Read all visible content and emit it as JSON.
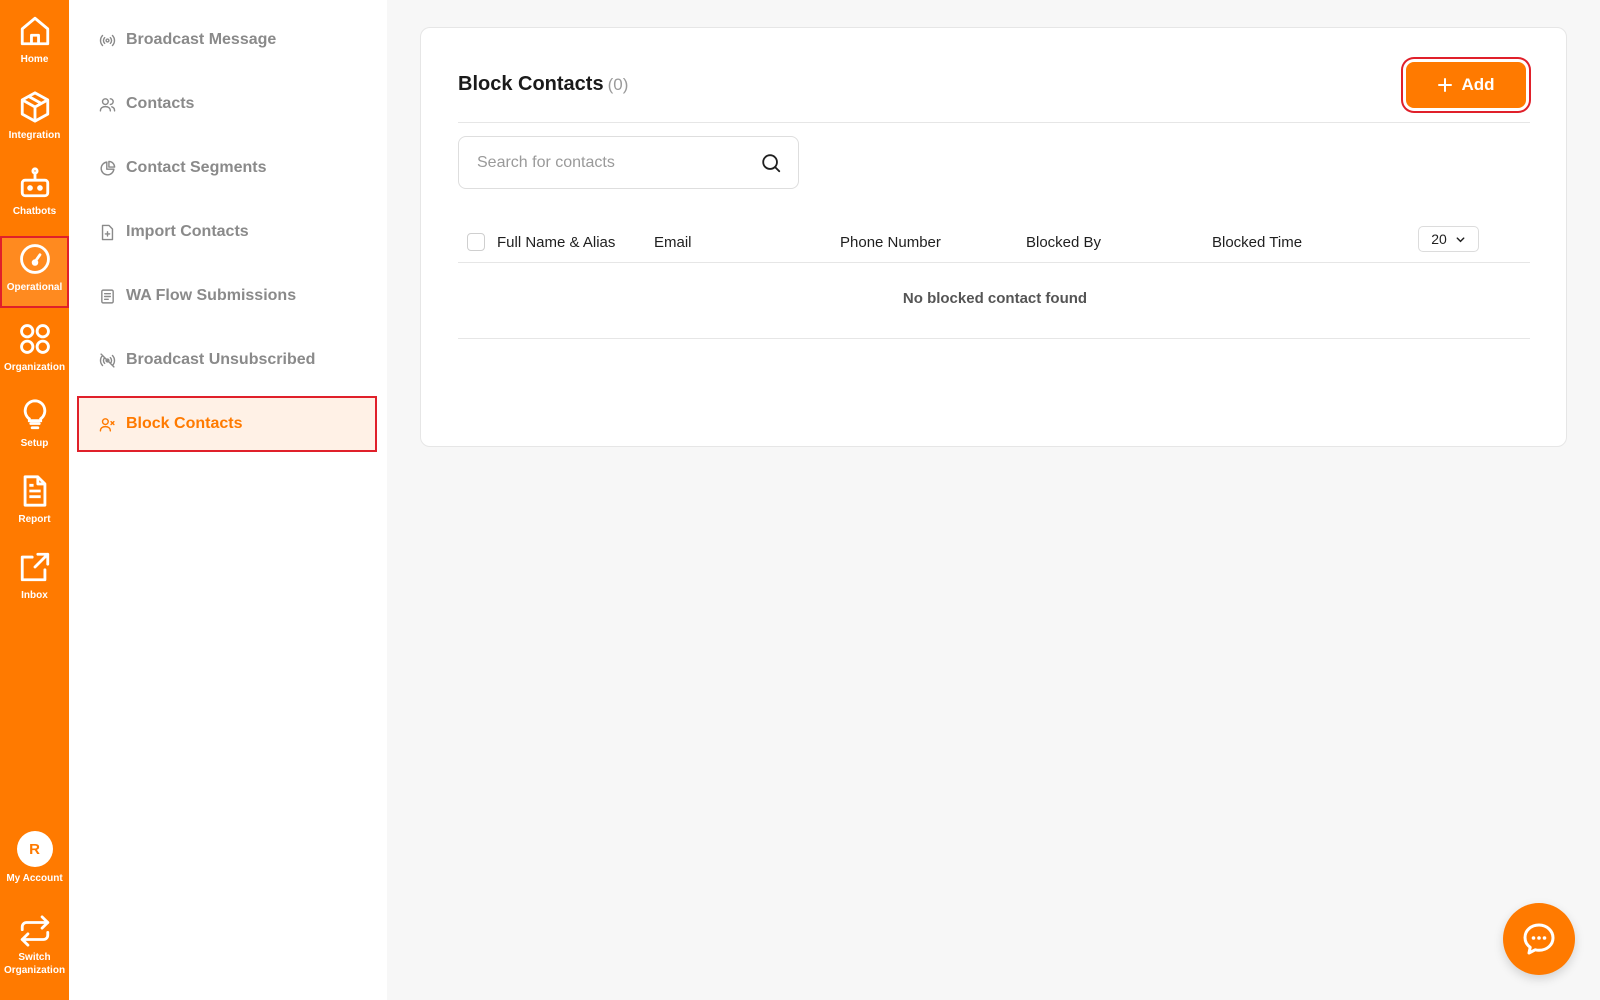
{
  "rail": {
    "items": [
      {
        "label": "Home",
        "icon": "home-icon"
      },
      {
        "label": "Integration",
        "icon": "cube-icon"
      },
      {
        "label": "Chatbots",
        "icon": "robot-icon"
      },
      {
        "label": "Operational",
        "icon": "gauge-icon"
      },
      {
        "label": "Organization",
        "icon": "grid-circles-icon"
      },
      {
        "label": "Setup",
        "icon": "lightbulb-icon"
      },
      {
        "label": "Report",
        "icon": "document-icon"
      },
      {
        "label": "Inbox",
        "icon": "external-link-icon"
      }
    ],
    "account": {
      "initial": "R",
      "label": "My Account"
    },
    "switch": {
      "label_line1": "Switch",
      "label_line2": "Organization"
    }
  },
  "subnav": {
    "items": [
      {
        "label": "Broadcast Message",
        "icon": "broadcast-icon"
      },
      {
        "label": "Contacts",
        "icon": "users-icon"
      },
      {
        "label": "Contact Segments",
        "icon": "pie-chart-icon"
      },
      {
        "label": "Import Contacts",
        "icon": "file-plus-icon"
      },
      {
        "label": "WA Flow Submissions",
        "icon": "list-document-icon"
      },
      {
        "label": "Broadcast Unsubscribed",
        "icon": "broadcast-off-icon"
      },
      {
        "label": "Block Contacts",
        "icon": "user-x-icon"
      }
    ]
  },
  "main": {
    "title": "Block Contacts",
    "count": "(0)",
    "add_label": "Add",
    "search": {
      "placeholder": "Search for contacts"
    },
    "table": {
      "columns": [
        "Full Name & Alias",
        "Email",
        "Phone Number",
        "Blocked By",
        "Blocked Time"
      ],
      "page_size": "20",
      "empty_message": "No blocked contact found"
    }
  },
  "colors": {
    "brand": "#ff7a00",
    "highlight": "#e0202a",
    "active_bg": "#fff1e6"
  }
}
